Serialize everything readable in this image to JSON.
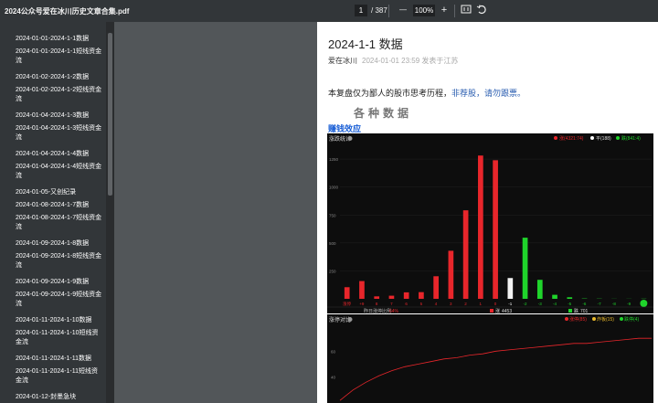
{
  "window": {
    "title": "2024公众号爱在冰川历史文章合集.pdf"
  },
  "toolbar": {
    "page_current": "1",
    "page_total": "/ 387",
    "zoom_minus": "—",
    "zoom": "100%",
    "zoom_plus": "+"
  },
  "sidebar": {
    "items": [
      {
        "label": "2024-01-01-2024-1-1数据"
      },
      {
        "label": "2024-01-01-2024-1-1短线资金流"
      },
      {
        "label": "2024-01-02-2024-1-2数据"
      },
      {
        "label": "2024-01-02-2024-1-2短线资金流"
      },
      {
        "label": "2024-01-04-2024-1-3数据"
      },
      {
        "label": "2024-01-04-2024-1-3短线资金流"
      },
      {
        "label": "2024-01-04-2024-1-4数据"
      },
      {
        "label": "2024-01-04-2024-1-4短线资金流"
      },
      {
        "label": "2024-01-05-又创纪录"
      },
      {
        "label": "2024-01-08-2024-1-7数据"
      },
      {
        "label": "2024-01-08-2024-1-7短线资金流"
      },
      {
        "label": "2024-01-09-2024-1-8数据"
      },
      {
        "label": "2024-01-09-2024-1-8短线资金流"
      },
      {
        "label": "2024-01-09-2024-1-9数据"
      },
      {
        "label": "2024-01-09-2024-1-9短线资金流"
      },
      {
        "label": "2024-01-11-2024-1-10数据"
      },
      {
        "label": "2024-01-11-2024-1-10短线资金流"
      },
      {
        "label": "2024-01-11-2024-1-11数据"
      },
      {
        "label": "2024-01-11-2024-1-11短线资金流"
      },
      {
        "label": "2024-01-12-封墨急块"
      }
    ]
  },
  "document": {
    "title": "2024-1-1 数据",
    "author": "爱在冰川",
    "meta": "2024-01-01 23:59  发表于江苏",
    "intro_text": "本复盘仅为鄙人的股市思考历程，",
    "intro_highlight": "非荐股，请勿跟票。",
    "section_heading": "各种数据",
    "sub_heading": "赚钱效应"
  },
  "chart_data": [
    {
      "type": "bar",
      "title": "涨跌统计",
      "legend_red": "涨(4321:74)",
      "legend_white": "平(188)",
      "legend_green": "跌(841:4)",
      "categories": [
        "涨停",
        "+9",
        "8",
        "7",
        "6",
        "5",
        "4",
        "3",
        "2",
        "1",
        "0",
        "-1",
        "-2",
        "-3",
        "-4",
        "-5",
        "-6",
        "-7",
        "-8",
        "-9",
        "跌停"
      ],
      "values": [
        104,
        159,
        22,
        28,
        58,
        60,
        202,
        430,
        792,
        1282,
        1240,
        186,
        547,
        170,
        36,
        14,
        3,
        2,
        1,
        1,
        2
      ],
      "colors": [
        "red",
        "red",
        "red",
        "red",
        "red",
        "red",
        "red",
        "red",
        "red",
        "red",
        "red",
        "white",
        "green",
        "green",
        "green",
        "green",
        "green",
        "green",
        "green",
        "green",
        "green"
      ],
      "ylim": [
        0,
        1300
      ],
      "yticks": [
        "1250",
        "1000",
        "750",
        "500",
        "250"
      ],
      "footer_left": "昨日涨停比例",
      "footer_left_value": "64%",
      "footer_up_label": "涨",
      "footer_up_value": "4453",
      "footer_down_label": "跌",
      "footer_down_value": "701",
      "accent_red": "#e8262b",
      "accent_green": "#1fd42b"
    },
    {
      "type": "line",
      "title": "涨停对比",
      "legend": [
        "涨停(85)",
        "炸板(15)",
        "跌停(4)"
      ],
      "yticks": [
        "60",
        "40"
      ],
      "x": [
        0,
        10,
        20,
        30,
        40,
        50,
        60,
        70,
        80,
        90,
        100,
        110,
        120,
        130,
        140,
        150,
        160,
        170,
        180,
        190,
        200,
        210,
        220,
        230,
        240
      ],
      "y": [
        22,
        30,
        36,
        41,
        45,
        48,
        50,
        52,
        54,
        55,
        57,
        58,
        60,
        61,
        62,
        63,
        64,
        65,
        66,
        66,
        67,
        68,
        69,
        70,
        70
      ],
      "ylim": [
        20,
        80
      ]
    }
  ]
}
